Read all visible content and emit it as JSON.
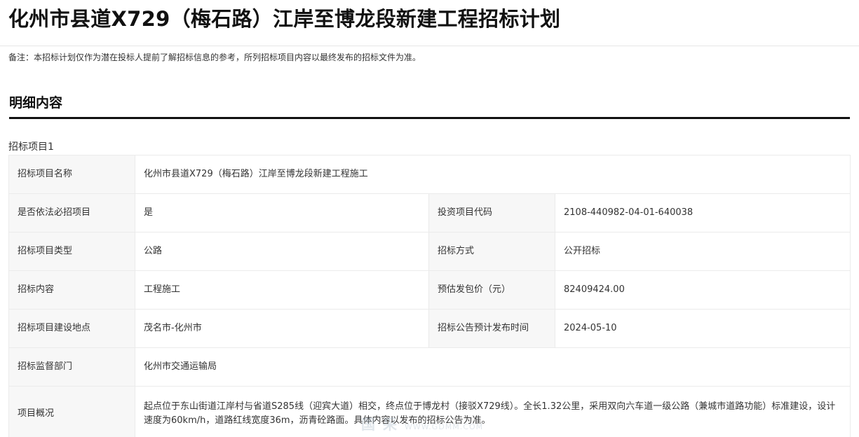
{
  "page": {
    "title": "化州市县道X729（梅石路）江岸至博龙段新建工程招标计划",
    "notice": "备注：本招标计划仅作为潜在投标人提前了解招标信息的参考，所列招标项目内容以最终发布的招标文件为准。"
  },
  "section": {
    "title": "明细内容",
    "item_label": "招标项目1"
  },
  "table": {
    "project_name_label": "招标项目名称",
    "project_name": "化州市县道X729（梅石路）江岸至博龙段新建工程施工",
    "must_tender_label": "是否依法必招项目",
    "must_tender": "是",
    "invest_code_label": "投资项目代码",
    "invest_code": "2108-440982-04-01-640038",
    "project_type_label": "招标项目类型",
    "project_type": "公路",
    "tender_method_label": "招标方式",
    "tender_method": "公开招标",
    "content_label": "招标内容",
    "content": "工程施工",
    "est_price_label": "预估发包价（元）",
    "est_price": "82409424.00",
    "location_label": "招标项目建设地点",
    "location": "茂名市-化州市",
    "publish_date_label": "招标公告预计发布时间",
    "publish_date": "2024-05-10",
    "supervisor_label": "招标监督部门",
    "supervisor": "化州市交通运输局",
    "overview_label": "项目概况",
    "overview": "起点位于东山街道江岸村与省道S285线（迎宾大道）相交，终点位于博龙村（接驳X729线）。全长1.32公里，采用双向六车道一级公路（兼城市道路功能）标准建设，设计速度为60km/h，道路红线宽度36m，沥青砼路面。具体内容以发布的招标公告为准。"
  },
  "watermark": {
    "main": "国 采",
    "sub": "WWW.GDMM.COM"
  }
}
